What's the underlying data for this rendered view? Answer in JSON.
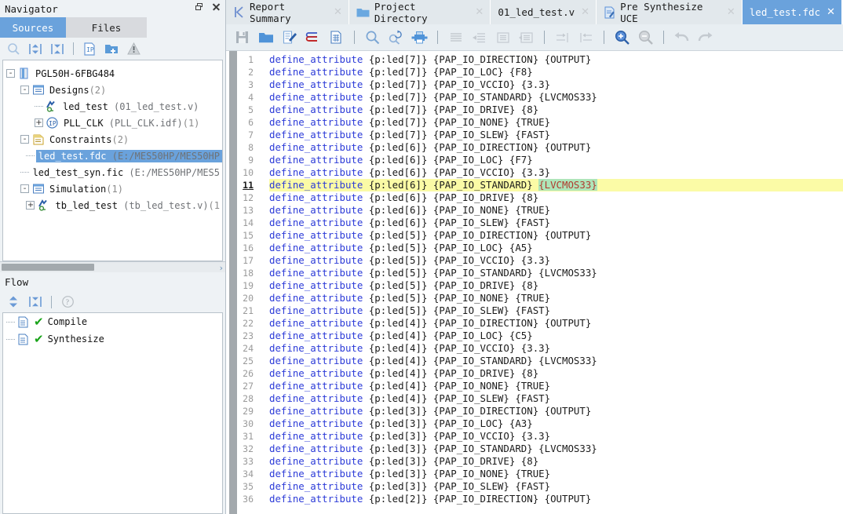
{
  "navigator": {
    "title": "Navigator",
    "restore_icon": "restore-icon",
    "close_icon": "close-icon",
    "tabs": [
      {
        "label": "Sources",
        "active": true
      },
      {
        "label": "Files",
        "active": false
      }
    ],
    "toolbar": [
      {
        "name": "search-icon",
        "tooltip": "Search"
      },
      {
        "name": "expand-all-icon",
        "tooltip": "Expand All"
      },
      {
        "name": "collapse-all-icon",
        "tooltip": "Collapse All"
      },
      {
        "name": "add-ip-icon",
        "tooltip": "Add IP"
      },
      {
        "name": "add-folder-icon",
        "tooltip": "Add Folder"
      },
      {
        "name": "warning-icon",
        "tooltip": "Warnings"
      }
    ],
    "tree": [
      {
        "depth": 0,
        "expander": "-",
        "icon": "chip-icon",
        "label": "PGL50H-6FBG484",
        "count": "",
        "path": "",
        "selected": false
      },
      {
        "depth": 1,
        "expander": "-",
        "icon": "designs-icon",
        "label": "Designs",
        "count": "(2)",
        "path": "",
        "selected": false
      },
      {
        "depth": 2,
        "expander": "",
        "icon": "verilog-icon",
        "label": "led_test",
        "count": "",
        "path": "(01_led_test.v)",
        "selected": false
      },
      {
        "depth": 2,
        "expander": "+",
        "icon": "ip-icon",
        "label": "PLL_CLK",
        "count": "(1)",
        "path": "(PLL_CLK.idf)",
        "selected": false
      },
      {
        "depth": 1,
        "expander": "-",
        "icon": "constraints-icon",
        "label": "Constraints",
        "count": "(2)",
        "path": "",
        "selected": false
      },
      {
        "depth": 2,
        "expander": "",
        "icon": "none",
        "label": "led_test.fdc",
        "count": "",
        "path": "(E:/MES50HP/MES50HP",
        "selected": true
      },
      {
        "depth": 2,
        "expander": "",
        "icon": "none",
        "label": "led_test_syn.fic",
        "count": "",
        "path": "(E:/MES50HP/MES5",
        "selected": false
      },
      {
        "depth": 1,
        "expander": "-",
        "icon": "simulation-icon",
        "label": "Simulation",
        "count": "(1)",
        "path": "",
        "selected": false
      },
      {
        "depth": 2,
        "expander": "+",
        "icon": "verilog-icon",
        "label": "tb_led_test",
        "count": "(1",
        "path": "(tb_led_test.v)",
        "selected": false
      }
    ],
    "hscrollbar": {
      "name": "tree-horizontal-scrollbar",
      "arrow": "›"
    }
  },
  "flow": {
    "title": "Flow",
    "toolbar": [
      {
        "name": "expand-collapse-icon"
      },
      {
        "name": "collapse-all-icon"
      },
      {
        "name": "help-icon"
      }
    ],
    "items": [
      {
        "label": "Compile",
        "status_icon": "green-check-icon",
        "doc_icon": "document-icon"
      },
      {
        "label": "Synthesize",
        "status_icon": "green-check-icon",
        "doc_icon": "document-icon"
      }
    ]
  },
  "editor": {
    "tabs": [
      {
        "label": "Report Summary",
        "icon": "report-icon",
        "active": false,
        "close": "✕"
      },
      {
        "label": "Project Directory",
        "icon": "folder-icon",
        "active": false,
        "close": "✕"
      },
      {
        "label": "01_led_test.v",
        "icon": "none",
        "active": false,
        "close": "✕"
      },
      {
        "label": "Pre Synthesize UCE",
        "icon": "uce-icon",
        "active": false,
        "close": "✕"
      },
      {
        "label": "led_test.fdc",
        "icon": "none",
        "active": true,
        "close": "✕"
      }
    ],
    "toolbar": [
      {
        "name": "save-icon",
        "enabled": true
      },
      {
        "name": "open-folder-icon",
        "enabled": true
      },
      {
        "name": "edit-document-icon",
        "enabled": true
      },
      {
        "name": "bookmark-lines-icon",
        "enabled": true
      },
      {
        "name": "table-document-icon",
        "enabled": true
      },
      {
        "name": "find-icon",
        "enabled": true
      },
      {
        "name": "find-replace-icon",
        "enabled": true
      },
      {
        "name": "print-icon",
        "enabled": true
      },
      {
        "name": "align-icon",
        "enabled": false
      },
      {
        "name": "outdent-icon",
        "enabled": false
      },
      {
        "name": "comment-icon",
        "enabled": false
      },
      {
        "name": "uncomment-icon",
        "enabled": false
      },
      {
        "name": "increase-indent-icon",
        "enabled": false
      },
      {
        "name": "decrease-indent-icon",
        "enabled": false
      },
      {
        "name": "zoom-in-icon",
        "enabled": true
      },
      {
        "name": "zoom-out-icon",
        "enabled": false
      },
      {
        "name": "undo-icon",
        "enabled": false
      },
      {
        "name": "redo-icon",
        "enabled": false
      }
    ],
    "current_line": 11,
    "lines": [
      {
        "n": 1,
        "kw": "define_attribute",
        "rest": " {p:led[7]} {PAP_IO_DIRECTION} {OUTPUT}"
      },
      {
        "n": 2,
        "kw": "define_attribute",
        "rest": " {p:led[7]} {PAP_IO_LOC} {F8}"
      },
      {
        "n": 3,
        "kw": "define_attribute",
        "rest": " {p:led[7]} {PAP_IO_VCCIO} {3.3}"
      },
      {
        "n": 4,
        "kw": "define_attribute",
        "rest": " {p:led[7]} {PAP_IO_STANDARD} {LVCMOS33}"
      },
      {
        "n": 5,
        "kw": "define_attribute",
        "rest": " {p:led[7]} {PAP_IO_DRIVE} {8}"
      },
      {
        "n": 6,
        "kw": "define_attribute",
        "rest": " {p:led[7]} {PAP_IO_NONE} {TRUE}"
      },
      {
        "n": 7,
        "kw": "define_attribute",
        "rest": " {p:led[7]} {PAP_IO_SLEW} {FAST}"
      },
      {
        "n": 8,
        "kw": "define_attribute",
        "rest": " {p:led[6]} {PAP_IO_DIRECTION} {OUTPUT}"
      },
      {
        "n": 9,
        "kw": "define_attribute",
        "rest": " {p:led[6]} {PAP_IO_LOC} {F7}"
      },
      {
        "n": 10,
        "kw": "define_attribute",
        "rest": " {p:led[6]} {PAP_IO_VCCIO} {3.3}"
      },
      {
        "n": 11,
        "kw": "define_attribute",
        "rest": " {p:led[6]} {PAP_IO_STANDARD} ",
        "highlight": true,
        "token": "{LVCMOS33}"
      },
      {
        "n": 12,
        "kw": "define_attribute",
        "rest": " {p:led[6]} {PAP_IO_DRIVE} {8}"
      },
      {
        "n": 13,
        "kw": "define_attribute",
        "rest": " {p:led[6]} {PAP_IO_NONE} {TRUE}"
      },
      {
        "n": 14,
        "kw": "define_attribute",
        "rest": " {p:led[6]} {PAP_IO_SLEW} {FAST}"
      },
      {
        "n": 15,
        "kw": "define_attribute",
        "rest": " {p:led[5]} {PAP_IO_DIRECTION} {OUTPUT}"
      },
      {
        "n": 16,
        "kw": "define_attribute",
        "rest": " {p:led[5]} {PAP_IO_LOC} {A5}"
      },
      {
        "n": 17,
        "kw": "define_attribute",
        "rest": " {p:led[5]} {PAP_IO_VCCIO} {3.3}"
      },
      {
        "n": 18,
        "kw": "define_attribute",
        "rest": " {p:led[5]} {PAP_IO_STANDARD} {LVCMOS33}"
      },
      {
        "n": 19,
        "kw": "define_attribute",
        "rest": " {p:led[5]} {PAP_IO_DRIVE} {8}"
      },
      {
        "n": 20,
        "kw": "define_attribute",
        "rest": " {p:led[5]} {PAP_IO_NONE} {TRUE}"
      },
      {
        "n": 21,
        "kw": "define_attribute",
        "rest": " {p:led[5]} {PAP_IO_SLEW} {FAST}"
      },
      {
        "n": 22,
        "kw": "define_attribute",
        "rest": " {p:led[4]} {PAP_IO_DIRECTION} {OUTPUT}"
      },
      {
        "n": 23,
        "kw": "define_attribute",
        "rest": " {p:led[4]} {PAP_IO_LOC} {C5}"
      },
      {
        "n": 24,
        "kw": "define_attribute",
        "rest": " {p:led[4]} {PAP_IO_VCCIO} {3.3}"
      },
      {
        "n": 25,
        "kw": "define_attribute",
        "rest": " {p:led[4]} {PAP_IO_STANDARD} {LVCMOS33}"
      },
      {
        "n": 26,
        "kw": "define_attribute",
        "rest": " {p:led[4]} {PAP_IO_DRIVE} {8}"
      },
      {
        "n": 27,
        "kw": "define_attribute",
        "rest": " {p:led[4]} {PAP_IO_NONE} {TRUE}"
      },
      {
        "n": 28,
        "kw": "define_attribute",
        "rest": " {p:led[4]} {PAP_IO_SLEW} {FAST}"
      },
      {
        "n": 29,
        "kw": "define_attribute",
        "rest": " {p:led[3]} {PAP_IO_DIRECTION} {OUTPUT}"
      },
      {
        "n": 30,
        "kw": "define_attribute",
        "rest": " {p:led[3]} {PAP_IO_LOC} {A3}"
      },
      {
        "n": 31,
        "kw": "define_attribute",
        "rest": " {p:led[3]} {PAP_IO_VCCIO} {3.3}"
      },
      {
        "n": 32,
        "kw": "define_attribute",
        "rest": " {p:led[3]} {PAP_IO_STANDARD} {LVCMOS33}"
      },
      {
        "n": 33,
        "kw": "define_attribute",
        "rest": " {p:led[3]} {PAP_IO_DRIVE} {8}"
      },
      {
        "n": 34,
        "kw": "define_attribute",
        "rest": " {p:led[3]} {PAP_IO_NONE} {TRUE}"
      },
      {
        "n": 35,
        "kw": "define_attribute",
        "rest": " {p:led[3]} {PAP_IO_SLEW} {FAST}"
      },
      {
        "n": 36,
        "kw": "define_attribute",
        "rest": " {p:led[2]} {PAP_IO_DIRECTION} {OUTPUT}"
      }
    ]
  },
  "colors": {
    "accent": "#6aa2dc",
    "keyword": "#2c3bd8",
    "highlight_line": "#fbfba6",
    "token_highlight": "#aee5b9",
    "token_text": "#b03a2e",
    "panel_bg": "#eef2f5",
    "check_green": "#19a319"
  }
}
